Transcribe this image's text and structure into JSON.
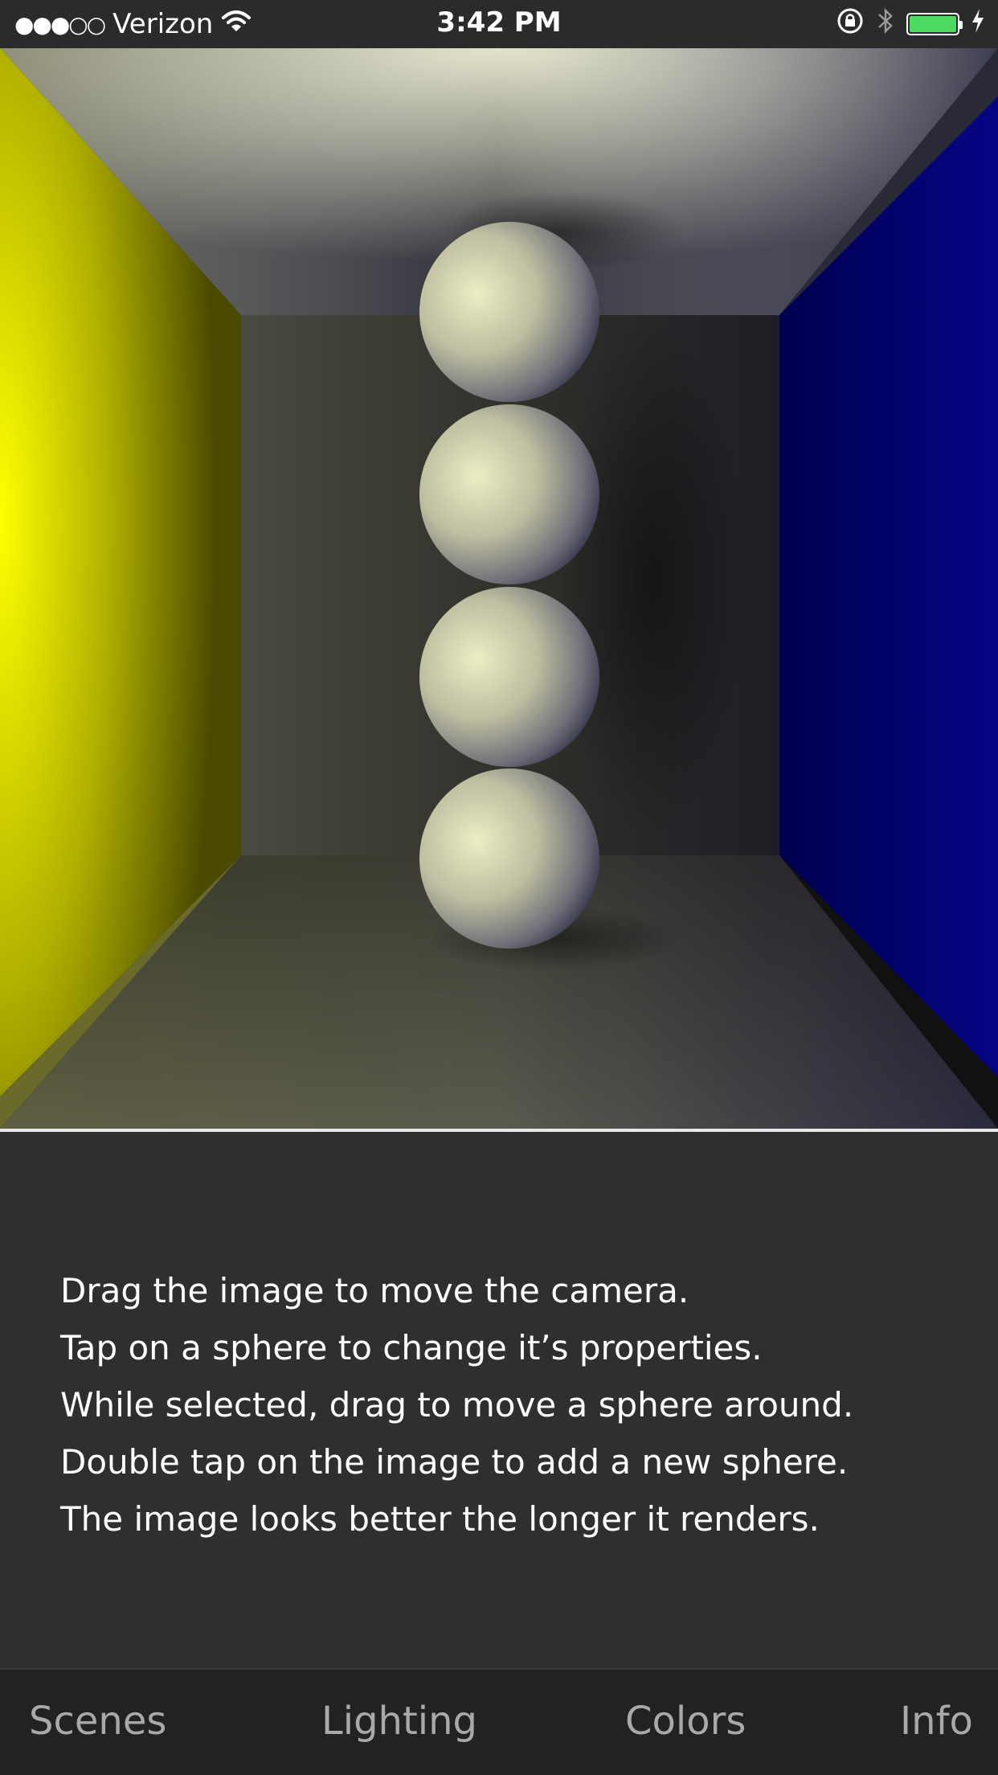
{
  "status_bar": {
    "signal": "●●●○○",
    "carrier": "Verizon",
    "time": "3:42 PM",
    "icons": [
      "wifi-icon",
      "rotation-lock-icon",
      "bluetooth-icon",
      "battery-icon",
      "charging-bolt-icon"
    ],
    "battery_color": "#4cd964"
  },
  "render": {
    "left_wall_color": "#e6e600",
    "right_wall_color": "#0a0a8c",
    "sphere_count": 4
  },
  "instructions": [
    "Drag the image to move the camera.",
    "Tap on a sphere to change it’s properties.",
    "While selected, drag to move a sphere around.",
    "Double tap on the image to add a new sphere.",
    "The image looks better the longer it renders."
  ],
  "tabs": [
    {
      "label": "Scenes"
    },
    {
      "label": "Lighting"
    },
    {
      "label": "Colors"
    },
    {
      "label": "Info"
    }
  ]
}
